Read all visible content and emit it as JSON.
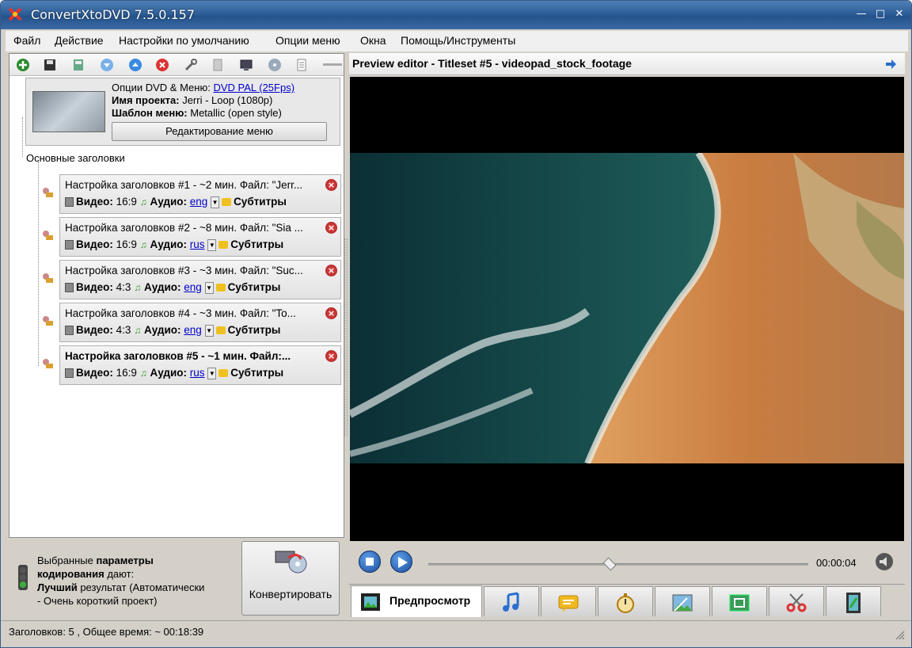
{
  "window": {
    "title": "ConvertXtoDVD 7.5.0.157"
  },
  "menu": [
    "Файл",
    "Действие",
    "Настройки по умолчанию",
    "Опции меню",
    "Окна",
    "Помощь/Инструменты"
  ],
  "project": {
    "options_label": "Опции DVD & Меню:",
    "options_link": "DVD PAL (25Fps)",
    "name_label": "Имя проекта:",
    "name_value": "Jerri - Loop (1080p)",
    "template_label": "Шаблон меню:",
    "template_value": "Metallic (open style)",
    "edit_button": "Редактирование меню"
  },
  "titles_section": "Основные заголовки",
  "titles": [
    {
      "header": "Настройка заголовков #1 - ~2 мин. Файл: \"Jerr...",
      "aspect": "16:9",
      "audio": "eng",
      "selected": false
    },
    {
      "header": "Настройка заголовков #2 - ~8 мин. Файл: \"Sia ...",
      "aspect": "16:9",
      "audio": "rus",
      "selected": false
    },
    {
      "header": "Настройка заголовков #3 - ~3 мин. Файл: \"Suc...",
      "aspect": "4:3",
      "audio": "eng",
      "selected": false
    },
    {
      "header": "Настройка заголовков #4 - ~3 мин. Файл: \"To...",
      "aspect": "4:3",
      "audio": "eng",
      "selected": false
    },
    {
      "header": "Настройка заголовков #5 - ~1 мин. Файл:...",
      "aspect": "16:9",
      "audio": "rus",
      "selected": true
    }
  ],
  "labels": {
    "video": "Видео:",
    "audio": "Аудио:",
    "subtitles": "Субтитры"
  },
  "encoding": {
    "line1a": "Выбранные ",
    "line1b": "параметры",
    "line2a": "кодирования",
    "line2b": " дают:",
    "line3a": "Лучший",
    "line3b": " результат (Автоматически",
    "line4": "- Очень короткий проект)"
  },
  "convert_button": "Конвертировать",
  "preview": {
    "title": "Preview editor - Titleset #5 - videopad_stock_footage",
    "time": "00:00:04"
  },
  "tabs": {
    "preview": "Предпросмотр"
  },
  "status": "Заголовков: 5 , Общее время: ~ 00:18:39",
  "colors": {
    "titlebar": "#2f5f98",
    "link": "#0000cc",
    "delete": "#c62828"
  }
}
